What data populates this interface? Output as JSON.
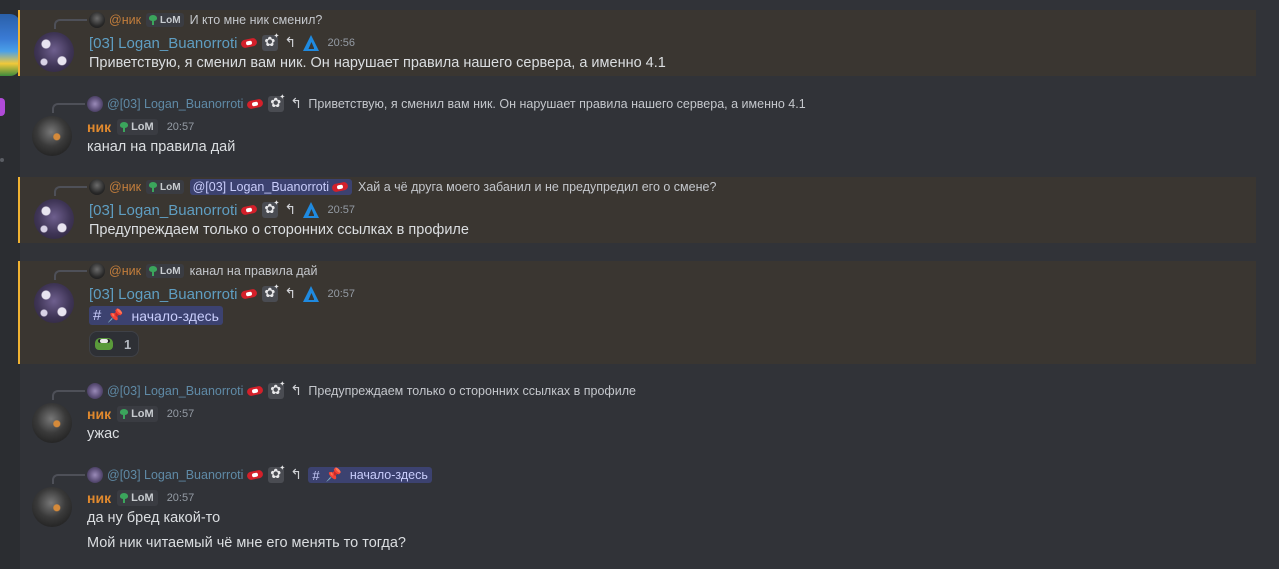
{
  "users": {
    "logan": {
      "name": "[03] Logan_Buanorroti",
      "mention": "@[03] Logan_Buanorroti"
    },
    "nik": {
      "name": "ник",
      "mention": "@ник",
      "tag": "LoM"
    }
  },
  "messages": [
    {
      "reply_text": "И кто мне ник сменил?",
      "time": "20:56",
      "content": "Приветствую, я сменил вам ник. Он нарушает правила нашего сервера, а именно 4.1"
    },
    {
      "reply_text": "Приветствую, я сменил вам ник. Он нарушает правила нашего сервера, а именно 4.1",
      "time": "20:57",
      "content": "канал на правила дай"
    },
    {
      "reply_text": "Хай а чё друга моего забанил и не предупредил его о смене?",
      "time": "20:57",
      "content": "Предупреждаем только о сторонних ссылках в профиле"
    },
    {
      "reply_text": "канал на правила дай",
      "time": "20:57",
      "channel": "начало-здесь",
      "reaction_count": "1"
    },
    {
      "reply_text": "Предупреждаем только о сторонних ссылках в профиле",
      "time": "20:57",
      "content": "ужас"
    },
    {
      "reply_channel": "начало-здесь",
      "time": "20:57",
      "content": "да ну бред какой-то",
      "content2": "Мой ник читаемый чё мне его менять то тогда?"
    }
  ],
  "colors": {
    "background": "#313338",
    "mention_bg": "#3a3631",
    "mention_border": "#f0b232",
    "logan_name": "#5f9ec2",
    "nik_name": "#e0892e",
    "channel_chip": "#3c4270"
  },
  "icons": [
    "flower-badge-icon",
    "red-ticket-badge-icon",
    "nail-badge-icon",
    "triangle-role-icon",
    "sprout-icon",
    "pin-icon",
    "frog-emoji-icon"
  ]
}
